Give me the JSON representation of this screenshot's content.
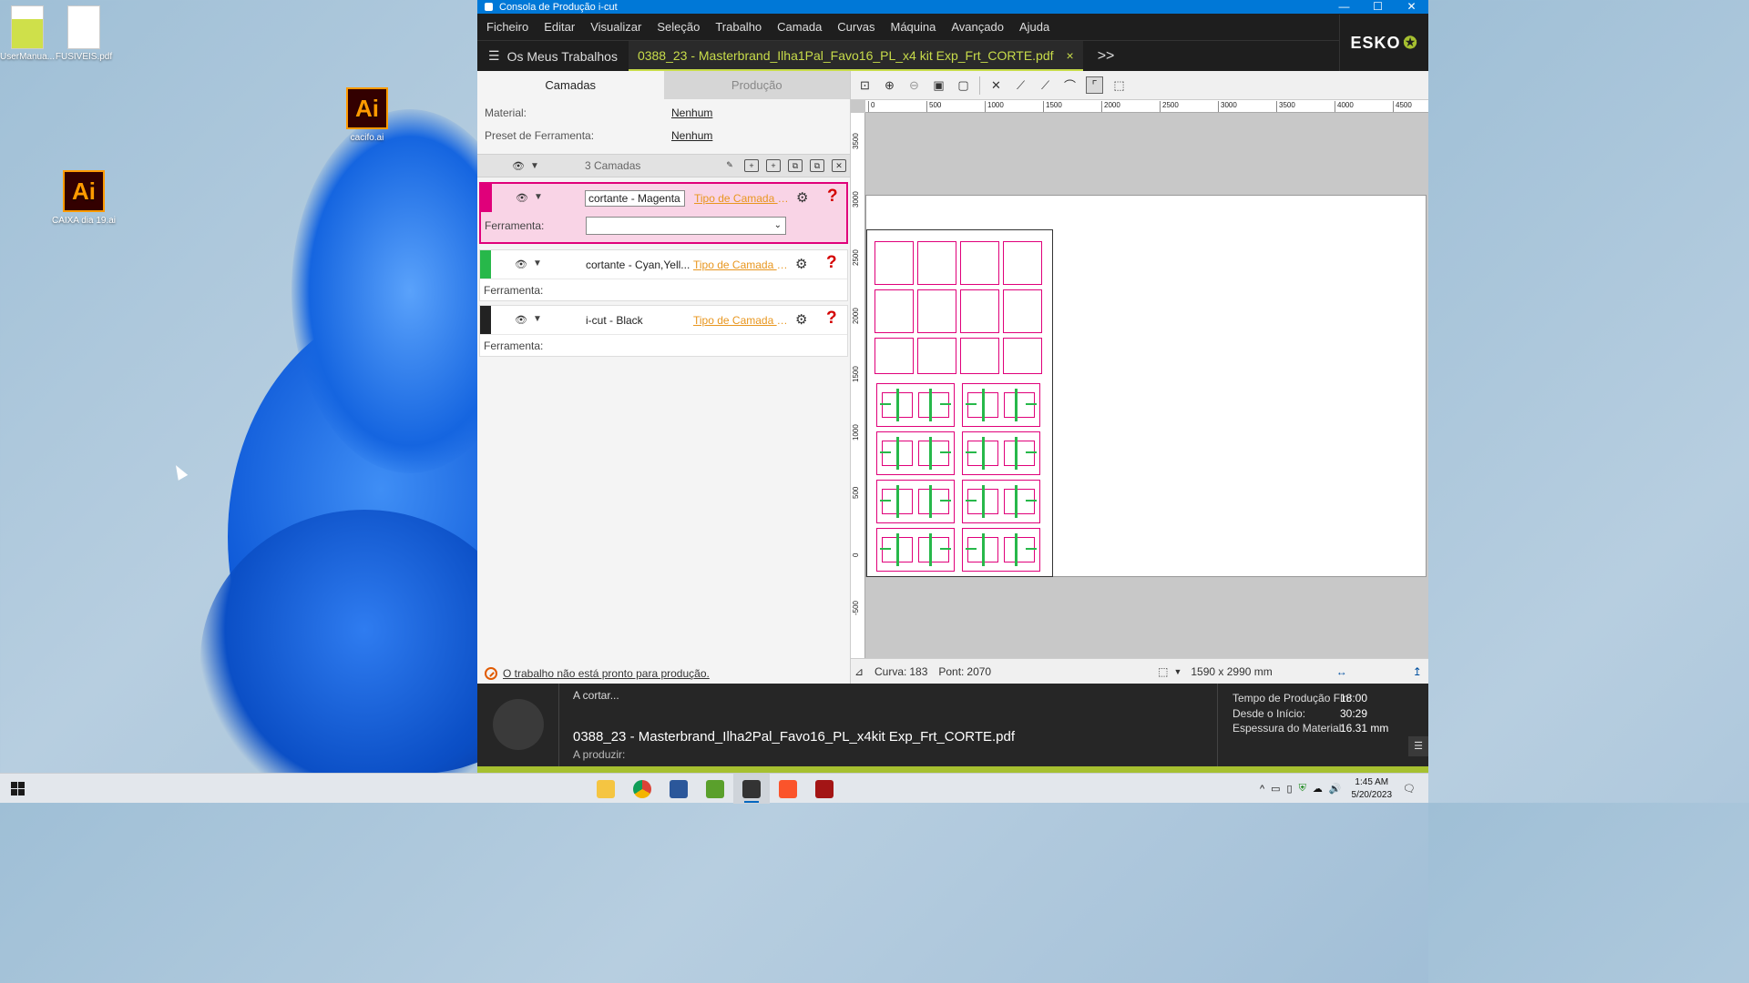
{
  "desktop": {
    "icons": [
      {
        "label": "UserManua...",
        "kind": "pdf"
      },
      {
        "label": "FUSIVEIS.pdf",
        "kind": "pdf"
      },
      {
        "label": "cacifo.ai",
        "kind": "ai"
      },
      {
        "label": "CAIXA dia 19.ai",
        "kind": "ai"
      }
    ],
    "ai_badge": "Ai"
  },
  "window": {
    "title": "Consola de Produção i-cut",
    "controls": {
      "minimize": "—",
      "maximize": "☐",
      "close": "✕"
    }
  },
  "menu": [
    "Ficheiro",
    "Editar",
    "Visualizar",
    "Seleção",
    "Trabalho",
    "Camada",
    "Curvas",
    "Máquina",
    "Avançado",
    "Ajuda"
  ],
  "tabs": {
    "my_jobs": "Os Meus Trabalhos",
    "file": "0388_23 - Masterbrand_Ilha1Pal_Favo16_PL_x4 kit Exp_Frt_CORTE.pdf",
    "close": "×",
    "more": ">>"
  },
  "brand": "ESKO",
  "panel_tabs": {
    "layers": "Camadas",
    "production": "Produção"
  },
  "properties": {
    "material_label": "Material:",
    "material_value": "Nenhum",
    "preset_label": "Preset de Ferramenta:",
    "preset_value": "Nenhum"
  },
  "layers_header": {
    "count": "3 Camadas"
  },
  "layers": [
    {
      "name": "cortante - Magenta",
      "type": "Tipo de Camada D...",
      "tool_label": "Ferramenta:",
      "color": "#e0007a",
      "selected": true
    },
    {
      "name": "cortante - Cyan,Yell...",
      "type": "Tipo de Camada D...",
      "tool_label": "Ferramenta:",
      "color": "#27b84a",
      "selected": false
    },
    {
      "name": "i-cut - Black",
      "type": "Tipo de Camada D...",
      "tool_label": "Ferramenta:",
      "color": "#222222",
      "selected": false
    }
  ],
  "status": {
    "message": "O trabalho não está pronto para produção."
  },
  "ruler": {
    "h_ticks": [
      "0",
      "500",
      "1000",
      "1500",
      "2000",
      "2500",
      "3000",
      "3500",
      "4000",
      "4500"
    ],
    "v_ticks": [
      "3500",
      "3000",
      "2500",
      "2000",
      "1500",
      "1000",
      "500",
      "0",
      "-500"
    ]
  },
  "info": {
    "curve_label": "Curva:",
    "curve_value": "183",
    "points_label": "Pont:",
    "points_value": "2070",
    "size": "1590 x 2990 mm"
  },
  "production": {
    "cutting": "A cortar...",
    "job_name": "0388_23 - Masterbrand_Ilha2Pal_Favo16_PL_x4kit Exp_Frt_CORTE.pdf",
    "producing": "A produzir:",
    "stats": [
      {
        "label": "Tempo de Produção Fin:",
        "value": "18:00"
      },
      {
        "label": "Desde o Início:",
        "value": "30:29"
      },
      {
        "label": "Espessura do Material:",
        "value": "16.31 mm"
      }
    ]
  },
  "taskbar": {
    "time": "1:45 AM",
    "date": "5/20/2023"
  }
}
